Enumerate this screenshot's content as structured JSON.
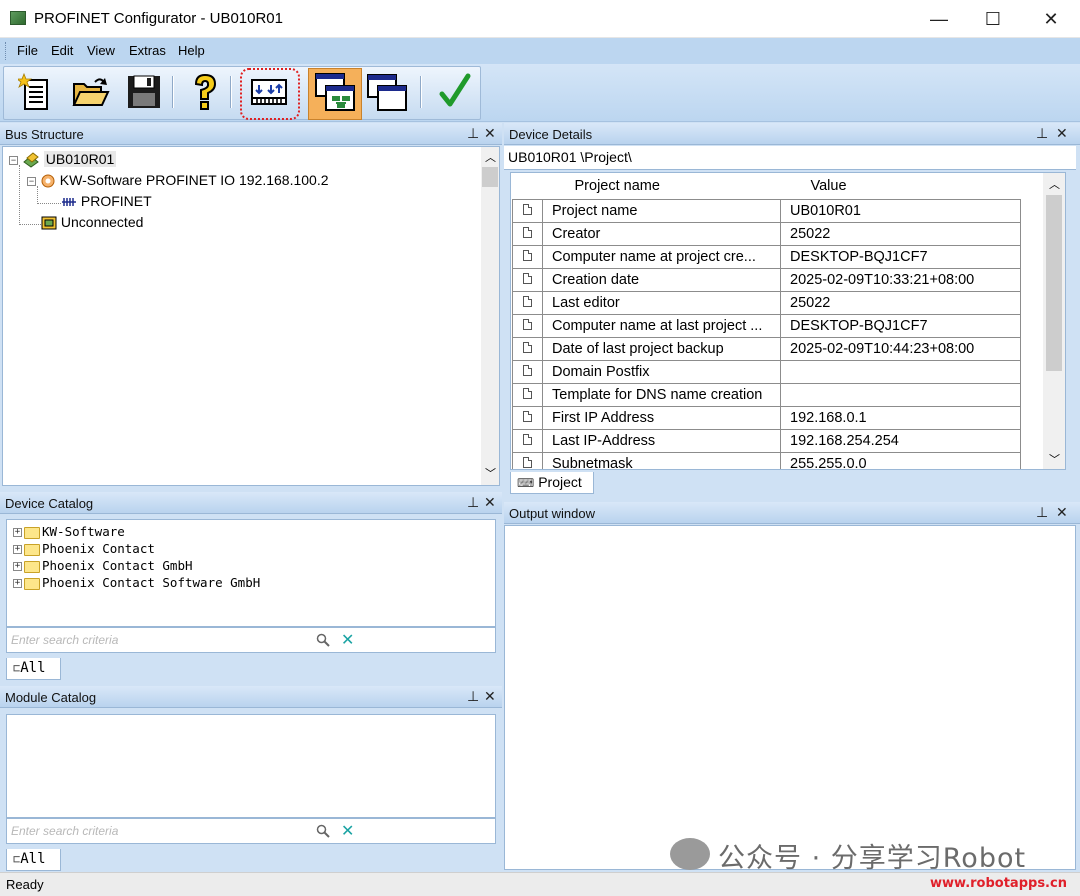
{
  "window": {
    "title": "PROFINET Configurator - UB010R01"
  },
  "window_controls": {
    "minimize": "—",
    "maximize": "☐",
    "close": "✕"
  },
  "menu": [
    "File",
    "Edit",
    "View",
    "Extras",
    "Help"
  ],
  "toolbar": {
    "icons": [
      "new-project-icon",
      "open-project-icon",
      "save-project-icon",
      "help-icon",
      "scan-network-icon",
      "network-view-icon",
      "window-icon",
      "check-icon"
    ],
    "active": "network-view-icon",
    "highlighted": "scan-network-icon"
  },
  "bus_structure": {
    "title": "Bus Structure",
    "tree": {
      "root": "UB010R01",
      "controller": "KW-Software PROFINET IO 192.168.100.2",
      "network": "PROFINET",
      "unconnected": "Unconnected"
    }
  },
  "device_details": {
    "title": "Device Details",
    "path": "UB010R01 \\Project\\",
    "columns": [
      "Project name",
      "Value"
    ],
    "rows": [
      {
        "name": "Project name",
        "value": "UB010R01"
      },
      {
        "name": "Creator",
        "value": "25022"
      },
      {
        "name": "Computer name at project cre...",
        "value": "DESKTOP-BQJ1CF7"
      },
      {
        "name": "Creation date",
        "value": "2025-02-09T10:33:21+08:00"
      },
      {
        "name": "Last editor",
        "value": "25022"
      },
      {
        "name": "Computer name at last project ...",
        "value": "DESKTOP-BQJ1CF7"
      },
      {
        "name": "Date of last project backup",
        "value": "2025-02-09T10:44:23+08:00"
      },
      {
        "name": "Domain Postfix",
        "value": ""
      },
      {
        "name": "Template for DNS name creation",
        "value": ""
      },
      {
        "name": "First IP Address",
        "value": "192.168.0.1"
      },
      {
        "name": "Last IP-Address",
        "value": "192.168.254.254"
      },
      {
        "name": "Subnetmask",
        "value": "255.255.0.0"
      }
    ],
    "tab": "Project"
  },
  "device_catalog": {
    "title": "Device Catalog",
    "items": [
      "KW-Software",
      "Phoenix Contact",
      "Phoenix Contact GmbH",
      "Phoenix Contact Software GmbH"
    ],
    "search_placeholder": "Enter search criteria",
    "tab": "All"
  },
  "module_catalog": {
    "title": "Module Catalog",
    "search_placeholder": "Enter search criteria",
    "tab": "All"
  },
  "output_window": {
    "title": "Output window"
  },
  "panel_controls": {
    "pin": "⊥",
    "close": "✕"
  },
  "status": {
    "text": "Ready"
  },
  "watermark": {
    "text": "公众号 · 分享学习Robot",
    "site": "www.robotapps.cn"
  },
  "colors": {
    "accent": "#bcd6f0",
    "annotation": "#e02020",
    "active_button": "#f5b05a"
  }
}
